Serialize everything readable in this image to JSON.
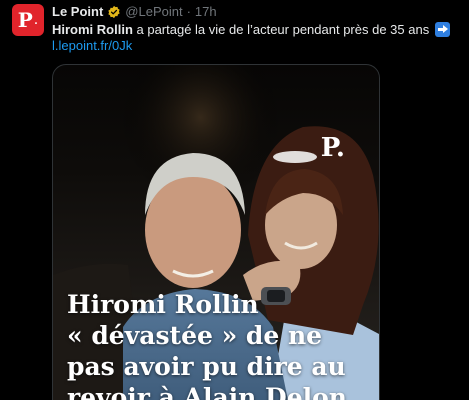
{
  "tweet": {
    "author_name": "Le Point",
    "handle": "@LePoint",
    "separator": "·",
    "time": "17h",
    "text_bold": "Hiromi Rollin",
    "text_rest": " a partagé la vie de l’acteur pendant près de 35 ans",
    "link": "l.lepoint.fr/0Jk"
  },
  "avatar": {
    "logo": "P"
  },
  "media": {
    "logo": "P.",
    "headline_lines": [
      "Hiromi Rollin",
      "« dévastée » de ne",
      "pas avoir pu dire au",
      "revoir à Alain Delon"
    ]
  },
  "colors": {
    "background": "#000000",
    "brand_red": "#e1242b",
    "link_blue": "#1d9bf0",
    "muted_gray": "#71767b",
    "verified_gold": "#e2b719",
    "arrow_blue": "#2f7fe0"
  },
  "icons": [
    "verified-badge-icon",
    "right-arrow-emoji-icon"
  ]
}
